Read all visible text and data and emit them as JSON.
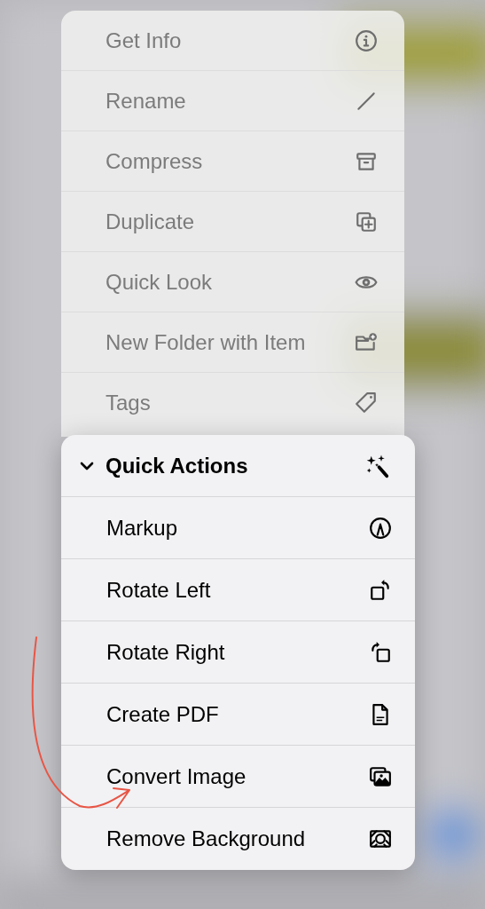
{
  "file_menu": {
    "items": [
      {
        "label": "Get Info"
      },
      {
        "label": "Rename"
      },
      {
        "label": "Compress"
      },
      {
        "label": "Duplicate"
      },
      {
        "label": "Quick Look"
      },
      {
        "label": "New Folder with Item"
      },
      {
        "label": "Tags"
      }
    ]
  },
  "quick_actions": {
    "title": "Quick Actions",
    "expanded": true,
    "items": [
      {
        "label": "Markup"
      },
      {
        "label": "Rotate Left"
      },
      {
        "label": "Rotate Right"
      },
      {
        "label": "Create PDF"
      },
      {
        "label": "Convert Image"
      },
      {
        "label": "Remove Background"
      }
    ]
  }
}
